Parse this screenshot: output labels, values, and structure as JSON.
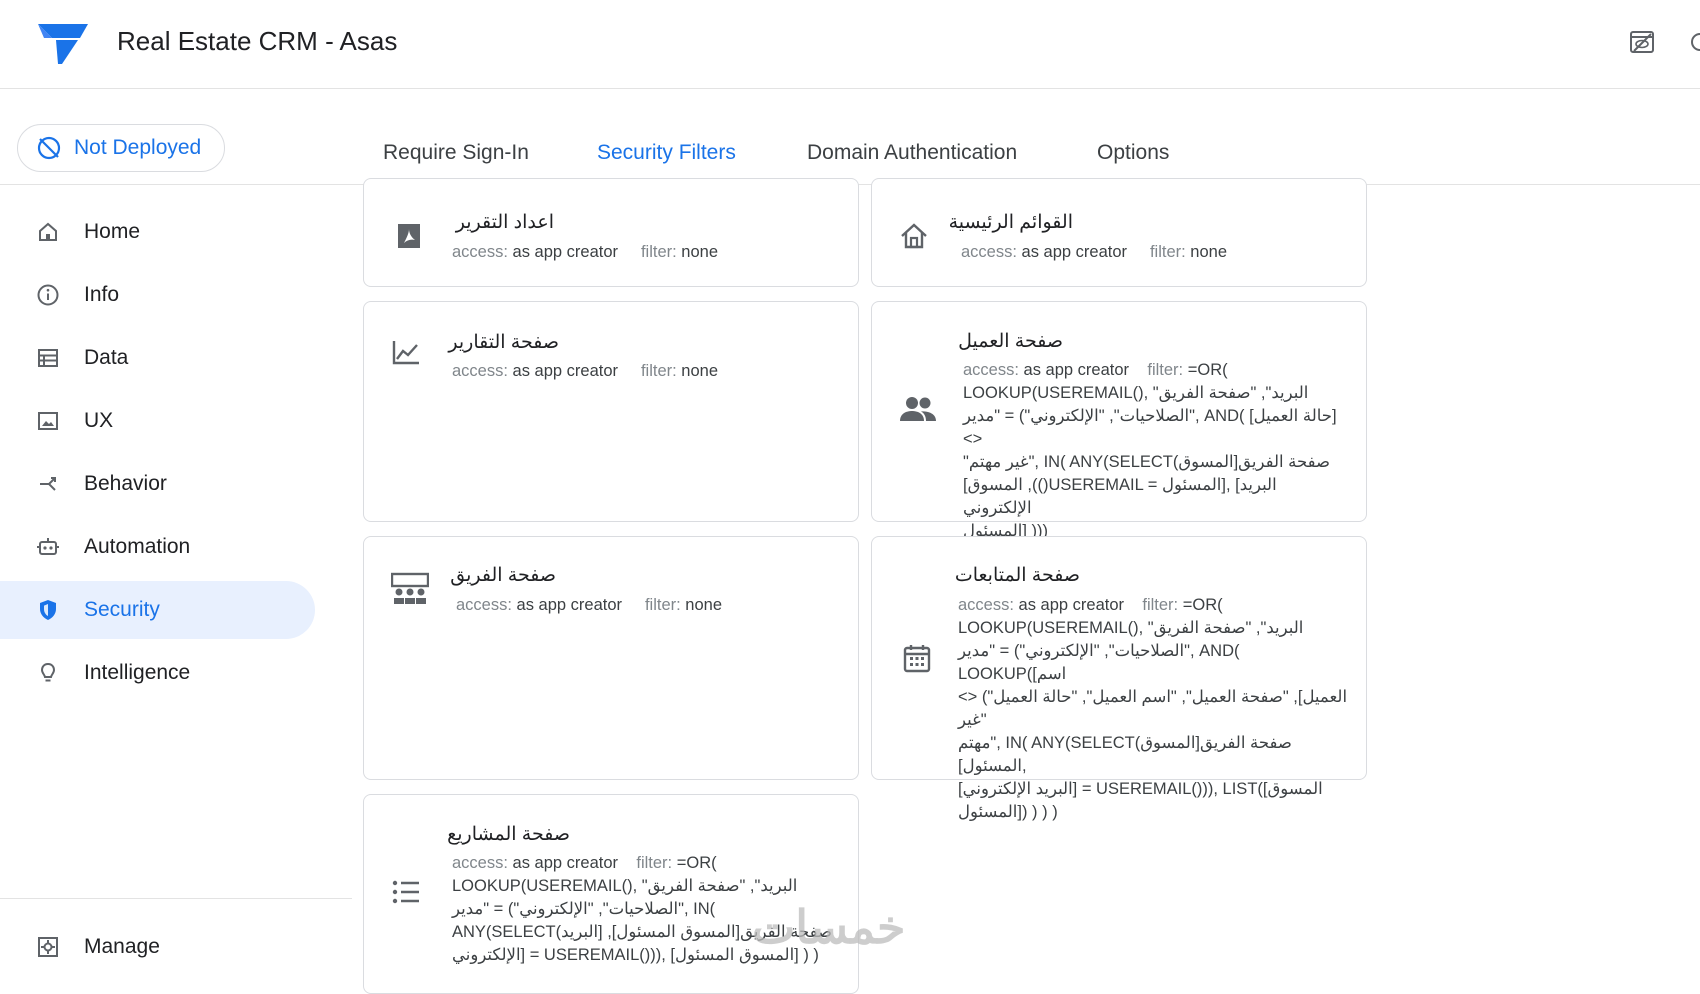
{
  "app": {
    "title": "Real Estate CRM - Asas"
  },
  "deploy": {
    "label": "Not Deployed"
  },
  "tabs": [
    {
      "label": "Require Sign-In"
    },
    {
      "label": "Security Filters"
    },
    {
      "label": "Domain Authentication"
    },
    {
      "label": "Options"
    }
  ],
  "sidebar": {
    "items": [
      {
        "label": "Home"
      },
      {
        "label": "Info"
      },
      {
        "label": "Data"
      },
      {
        "label": "UX"
      },
      {
        "label": "Behavior"
      },
      {
        "label": "Automation"
      },
      {
        "label": "Security"
      },
      {
        "label": "Intelligence"
      },
      {
        "label": "Manage"
      }
    ]
  },
  "meta_labels": {
    "access": "access:",
    "filter": "filter:"
  },
  "cards": [
    {
      "title": "اعداد التقرير",
      "access": "as app creator",
      "filter": "none",
      "icon": "pdf-icon"
    },
    {
      "title": "القوائم الرئيسية",
      "access": "as app creator",
      "filter": "none",
      "icon": "home-icon"
    },
    {
      "title": "صفحة التقارير",
      "access": "as app creator",
      "filter": "none",
      "icon": "trending-chart-icon"
    },
    {
      "title": "صفحة العميل",
      "access": "as app creator",
      "icon": "people-icon",
      "filter": "=OR(",
      "filter_lines": [
        "LOOKUP(USEREMAIL(), \"البريد\", \"صفحة الفريق",
        "الصلاحيات\", \"الإلكتروني\") = \"مدير\", AND( [حالة العميل] <>",
        "\"غير مهتم\", IN( ANY(SELECT(صفحة الفريق[المسوق",
        "[المسوق ,(()USEREMAIL = المسئول], [البريد الإلكتروني",
        "المسئول] )))"
      ]
    },
    {
      "title": "صفحة الفريق",
      "access": "as app creator",
      "filter": "none",
      "icon": "team-icon"
    },
    {
      "title": "صفحة المتابعات",
      "access": "as app creator",
      "icon": "calendar-icon",
      "filter": "=OR(",
      "filter_lines": [
        "LOOKUP(USEREMAIL(), \"البريد\", \"صفحة الفريق",
        "الصلاحيات\", \"الإلكتروني\") = \"مدير\", AND( LOOKUP([اسم",
        "العميل], \"صفحة العميل\", \"اسم العميل\", \"حالة العميل\") <> \"غير",
        "مهتم\", IN( ANY(SELECT(صفحة الفريق[المسوق المسئول],",
        "[البريد الإلكتروني] = USEREMAIL())), LIST([المسوق",
        "المسئول]) ) ) )"
      ]
    },
    {
      "title": "صفحة المشاريع",
      "access": "as app creator",
      "icon": "list-icon",
      "filter": "=OR(",
      "filter_lines": [
        "LOOKUP(USEREMAIL(), \"البريد\", \"صفحة الفريق",
        "الصلاحيات\", \"الإلكتروني\") = \"مدير\", IN(",
        "ANY(SELECT(صفحة الفريق[المسوق المسئول], [البريد",
        "الإلكتروني] = USEREMAIL())), [المسوق المسئول] ) )"
      ]
    }
  ],
  "watermark": "خمسات",
  "colors": {
    "accent": "#1a73e8",
    "active_bg": "#e8f0fe",
    "border": "#dadce0"
  }
}
